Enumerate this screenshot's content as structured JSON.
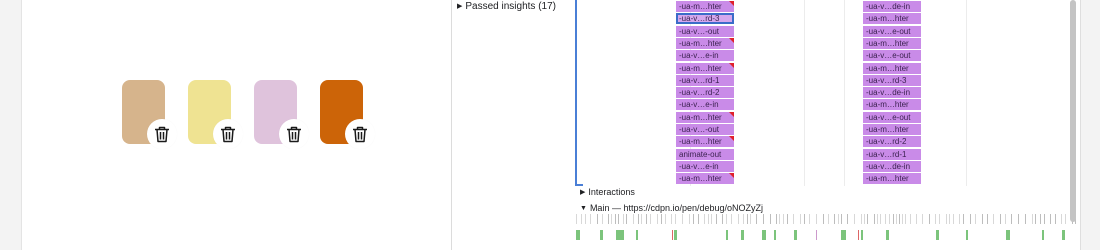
{
  "preview": {
    "cards": [
      {
        "color": "#d6b48c",
        "icon": "trash-icon"
      },
      {
        "color": "#efe392",
        "icon": "trash-icon"
      },
      {
        "color": "#dfc3dc",
        "icon": "trash-icon"
      },
      {
        "color": "#cc6408",
        "icon": "trash-icon"
      }
    ]
  },
  "devtools": {
    "passed_insights": "Passed insights (17)",
    "interactions_label": "Interactions",
    "main_label": "Main — https://cdpn.io/pen/debug/oNOZyZj",
    "colors": {
      "slot": "#c98be8",
      "selected_outline": "#3b6cc9",
      "marker": "#e0202a",
      "timeline_accent": "#4a7fd6"
    },
    "flame_left": [
      {
        "label": "-ua-m…hter",
        "marker": true
      },
      {
        "label": "-ua-v…rd-3",
        "selected": true
      },
      {
        "label": "-ua-v…-out"
      },
      {
        "label": "-ua-m…hter",
        "marker": true
      },
      {
        "label": "-ua-v…e-in"
      },
      {
        "label": "-ua-m…hter",
        "marker": true
      },
      {
        "label": "-ua-v…rd-1"
      },
      {
        "label": "-ua-v…rd-2"
      },
      {
        "label": "-ua-v…e-in"
      },
      {
        "label": "-ua-m…hter",
        "marker": true
      },
      {
        "label": "-ua-v…-out"
      },
      {
        "label": "-ua-m…hter",
        "marker": true
      },
      {
        "label": "animate-out"
      },
      {
        "label": "-ua-v…e-in"
      },
      {
        "label": "-ua-m…hter",
        "marker": true
      }
    ],
    "flame_right": [
      {
        "label": "-ua-v…de-in"
      },
      {
        "label": "-ua-m…hter"
      },
      {
        "label": "-ua-v…e-out"
      },
      {
        "label": "-ua-m…hter"
      },
      {
        "label": "-ua-v…e-out"
      },
      {
        "label": "-ua-m…hter"
      },
      {
        "label": "-ua-v…rd-3"
      },
      {
        "label": "-ua-v…de-in"
      },
      {
        "label": "-ua-m…hter"
      },
      {
        "label": "-ua-v…e-out"
      },
      {
        "label": "-ua-m…hter"
      },
      {
        "label": "-ua-v…rd-2"
      },
      {
        "label": "-ua-v…rd-1"
      },
      {
        "label": "-ua-v…de-in"
      },
      {
        "label": "-ua-m…hter"
      }
    ]
  }
}
